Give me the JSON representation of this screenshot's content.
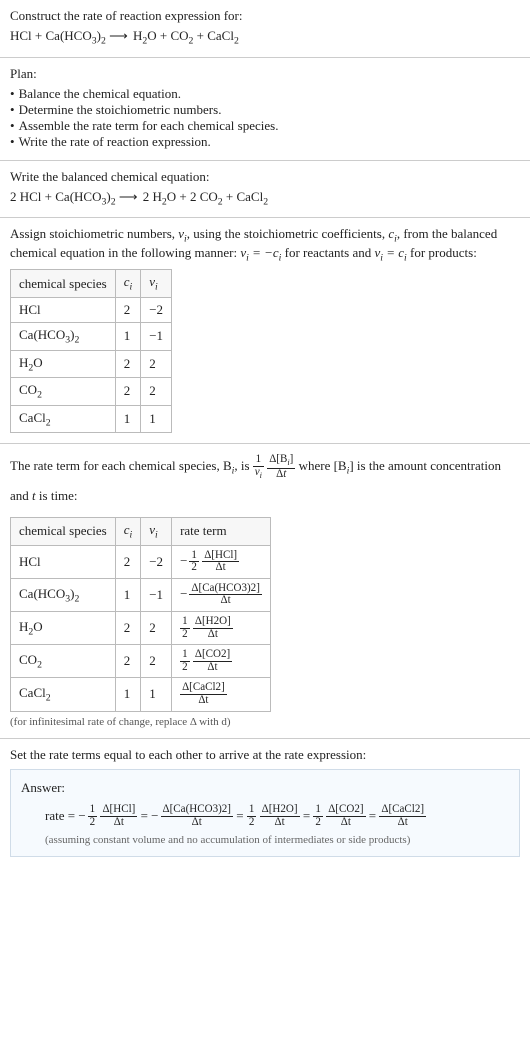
{
  "chart_data": {
    "type": "table",
    "title": "Stoichiometric numbers and rate terms",
    "tables": [
      {
        "name": "stoichiometry",
        "columns": [
          "chemical species",
          "c_i",
          "v_i"
        ],
        "rows": [
          [
            "HCl",
            2,
            -2
          ],
          [
            "Ca(HCO3)2",
            1,
            -1
          ],
          [
            "H2O",
            2,
            2
          ],
          [
            "CO2",
            2,
            2
          ],
          [
            "CaCl2",
            1,
            1
          ]
        ]
      },
      {
        "name": "rate_terms",
        "columns": [
          "chemical species",
          "c_i",
          "v_i",
          "rate term"
        ],
        "rows": [
          [
            "HCl",
            2,
            -2,
            "-(1/2) Δ[HCl]/Δt"
          ],
          [
            "Ca(HCO3)2",
            1,
            -1,
            "-Δ[Ca(HCO3)2]/Δt"
          ],
          [
            "H2O",
            2,
            2,
            "(1/2) Δ[H2O]/Δt"
          ],
          [
            "CO2",
            2,
            2,
            "(1/2) Δ[CO2]/Δt"
          ],
          [
            "CaCl2",
            1,
            1,
            "Δ[CaCl2]/Δt"
          ]
        ]
      }
    ]
  },
  "s1": {
    "title": "Construct the rate of reaction expression for:",
    "equation": "HCl + Ca(HCO3)2  ⟶  H2O + CO2 + CaCl2"
  },
  "s2": {
    "title": "Plan:",
    "items": [
      "Balance the chemical equation.",
      "Determine the stoichiometric numbers.",
      "Assemble the rate term for each chemical species.",
      "Write the rate of reaction expression."
    ]
  },
  "s3": {
    "title": "Write the balanced chemical equation:",
    "equation": "2 HCl + Ca(HCO3)2  ⟶  2 H2O + 2 CO2 + CaCl2"
  },
  "s4": {
    "intro_a": "Assign stoichiometric numbers, ",
    "intro_b": ", using the stoichiometric coefficients, ",
    "intro_c": ", from the balanced chemical equation in the following manner: ",
    "intro_d": " for reactants and ",
    "intro_e": " for products:",
    "vi": "v_i",
    "ci": "c_i",
    "rel_react": "v_i = −c_i",
    "rel_prod": "v_i = c_i",
    "headers": {
      "species": "chemical species",
      "ci": "c_i",
      "vi": "v_i"
    },
    "rows": [
      {
        "species": "HCl",
        "ci": "2",
        "vi": "−2"
      },
      {
        "species": "Ca(HCO3)2",
        "ci": "1",
        "vi": "−1"
      },
      {
        "species": "H2O",
        "ci": "2",
        "vi": "2"
      },
      {
        "species": "CO2",
        "ci": "2",
        "vi": "2"
      },
      {
        "species": "CaCl2",
        "ci": "1",
        "vi": "1"
      }
    ]
  },
  "s5": {
    "pre": "The rate term for each chemical species, B",
    "mid1": ", is ",
    "mid2": " where [B",
    "mid3": "] is the amount concentration and ",
    "tvar": "t",
    "tail": " is time:",
    "frac1_num": "1",
    "frac1_den": "v_i",
    "frac2_num": "Δ[B_i]",
    "frac2_den": "Δt",
    "headers": {
      "species": "chemical species",
      "ci": "c_i",
      "vi": "v_i",
      "rate": "rate term"
    },
    "rows": [
      {
        "species": "HCl",
        "ci": "2",
        "vi": "−2",
        "sign": "−",
        "coef_num": "1",
        "coef_den": "2",
        "delta_num": "Δ[HCl]",
        "delta_den": "Δt"
      },
      {
        "species": "Ca(HCO3)2",
        "ci": "1",
        "vi": "−1",
        "sign": "−",
        "coef_num": "",
        "coef_den": "",
        "delta_num": "Δ[Ca(HCO3)2]",
        "delta_den": "Δt"
      },
      {
        "species": "H2O",
        "ci": "2",
        "vi": "2",
        "sign": "",
        "coef_num": "1",
        "coef_den": "2",
        "delta_num": "Δ[H2O]",
        "delta_den": "Δt"
      },
      {
        "species": "CO2",
        "ci": "2",
        "vi": "2",
        "sign": "",
        "coef_num": "1",
        "coef_den": "2",
        "delta_num": "Δ[CO2]",
        "delta_den": "Δt"
      },
      {
        "species": "CaCl2",
        "ci": "1",
        "vi": "1",
        "sign": "",
        "coef_num": "",
        "coef_den": "",
        "delta_num": "Δ[CaCl2]",
        "delta_den": "Δt"
      }
    ],
    "note": "(for infinitesimal rate of change, replace Δ with d)"
  },
  "s6": {
    "title": "Set the rate terms equal to each other to arrive at the rate expression:",
    "answer_label": "Answer:",
    "rate_prefix": "rate = ",
    "terms": [
      {
        "sign": "−",
        "coef_num": "1",
        "coef_den": "2",
        "delta_num": "Δ[HCl]",
        "delta_den": "Δt"
      },
      {
        "sign": "−",
        "coef_num": "",
        "coef_den": "",
        "delta_num": "Δ[Ca(HCO3)2]",
        "delta_den": "Δt"
      },
      {
        "sign": "",
        "coef_num": "1",
        "coef_den": "2",
        "delta_num": "Δ[H2O]",
        "delta_den": "Δt"
      },
      {
        "sign": "",
        "coef_num": "1",
        "coef_den": "2",
        "delta_num": "Δ[CO2]",
        "delta_den": "Δt"
      },
      {
        "sign": "",
        "coef_num": "",
        "coef_den": "",
        "delta_num": "Δ[CaCl2]",
        "delta_den": "Δt"
      }
    ],
    "eq_sep": " = ",
    "assumption": "(assuming constant volume and no accumulation of intermediates or side products)"
  }
}
